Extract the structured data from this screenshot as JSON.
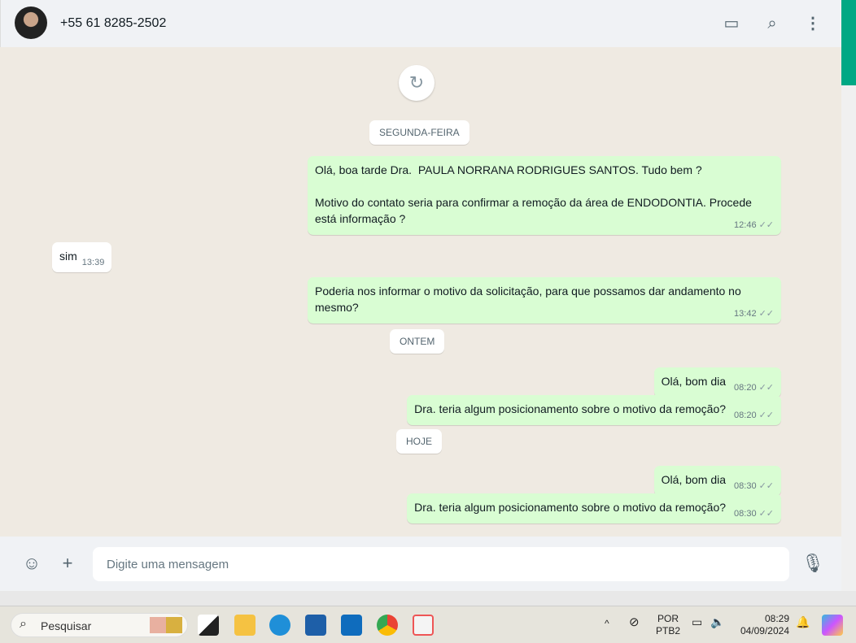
{
  "header": {
    "contact": "+55 61 8285-2502",
    "icons": [
      "catalog-icon",
      "search-icon",
      "menu-icon"
    ]
  },
  "chat": {
    "days": [
      "SEGUNDA-FEIRA",
      "ONTEM",
      "HOJE"
    ],
    "messages": [
      {
        "dir": "out",
        "text": "Olá, boa tarde Dra.  PAULA NORRANA RODRIGUES SANTOS. Tudo bem ?\n\nMotivo do contato seria para confirmar a remoção da área de ENDODONTIA. Procede está informação ?",
        "time": "12:46"
      },
      {
        "dir": "in",
        "text": "sim",
        "time": "13:39"
      },
      {
        "dir": "out",
        "text": "Poderia nos informar o motivo da solicitação, para que possamos dar andamento no mesmo?",
        "time": "13:42"
      },
      {
        "dir": "out",
        "text": "Olá, bom dia",
        "time": "08:20"
      },
      {
        "dir": "out",
        "text": "Dra. teria algum posicionamento sobre o motivo da remoção?",
        "time": "08:20"
      },
      {
        "dir": "out",
        "text": "Olá, bom dia",
        "time": "08:30"
      },
      {
        "dir": "out",
        "text": "Dra. teria algum posicionamento sobre o motivo da remoção?",
        "time": "08:30"
      }
    ]
  },
  "footer": {
    "placeholder": "Digite uma mensagem"
  },
  "taskbar": {
    "search": "Pesquisar",
    "lang1": "POR",
    "lang2": "PTB2",
    "time": "08:29",
    "date": "04/09/2024"
  },
  "colors": {
    "accent": "#00a884",
    "bubble_out": "#d9fdd3",
    "chat_bg": "#efeae2"
  }
}
